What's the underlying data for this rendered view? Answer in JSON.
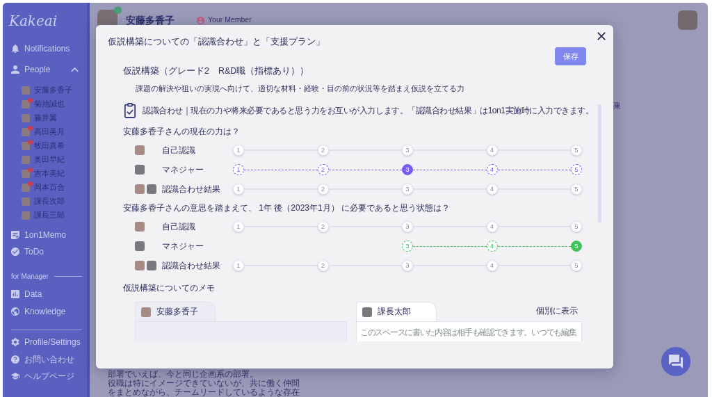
{
  "sidebar": {
    "logo": "Kakeai",
    "items": [
      {
        "label": "Notifications"
      },
      {
        "label": "People",
        "expanded": true,
        "children": [
          {
            "name": "安藤多香子",
            "alert": false
          },
          {
            "name": "菊池誠也",
            "alert": true
          },
          {
            "name": "藤井翼",
            "alert": false
          },
          {
            "name": "高田美月",
            "alert": true
          },
          {
            "name": "牧田真希",
            "alert": true
          },
          {
            "name": "奥田早紀",
            "alert": false
          },
          {
            "name": "吉本美紀",
            "alert": true
          },
          {
            "name": "岡本百合",
            "alert": true
          },
          {
            "name": "課長次郎",
            "alert": false
          },
          {
            "name": "課長三郎",
            "alert": false
          }
        ]
      },
      {
        "label": "1on1Memo"
      },
      {
        "label": "ToDo"
      }
    ],
    "section_label": "for Manager",
    "manager_items": [
      {
        "label": "Data"
      },
      {
        "label": "Knowledge"
      }
    ],
    "footer_items": [
      {
        "label": "Profile/Settings"
      },
      {
        "label": "お問い合わせ"
      },
      {
        "label": "ヘルプページ"
      }
    ]
  },
  "header": {
    "name": "安藤多香子",
    "online": true,
    "role": "Your Member"
  },
  "background": {
    "fragment": "果",
    "note_lines": [
      "部署でいえば、今と同じ企画系の部署。",
      "役職は特にイメージできていないが、共に働く仲間",
      "をまとめながら、チームリードしているような存在"
    ]
  },
  "dialog": {
    "title": "仮説構築についての「認識合わせ」と「支援プラン」",
    "save_button": "保存",
    "skill": {
      "title": "仮説構築（グレード2　R&D職（指標あり））",
      "description": "課題の解決や狙いの実現へ向けて、適切な材料・経験・目の前の状況等を踏まえ仮説を立てる力"
    },
    "notice": "認識合わせ｜現在の力や将来必要であると思う力をお互いが入力します。「認識合わせ結果」は1on1実施時に入力できます。",
    "questions": [
      {
        "text": "安藤多香子さんの現在の力は？",
        "rows": [
          {
            "kind": "self",
            "label": "自己認識",
            "points": [
              {
                "label": "1",
                "selected": false
              },
              {
                "label": "2",
                "selected": false
              },
              {
                "label": "3",
                "selected": false
              },
              {
                "label": "4",
                "selected": false
              },
              {
                "label": "5",
                "selected": false
              }
            ]
          },
          {
            "kind": "manager",
            "label": "マネジャー",
            "color": "#7b5cf2",
            "points": [
              {
                "label": "1",
                "selected": false
              },
              {
                "label": "2",
                "selected": false
              },
              {
                "label": "3",
                "selected": true
              },
              {
                "label": "4",
                "selected": false
              },
              {
                "label": "5",
                "selected": false
              }
            ]
          },
          {
            "kind": "result",
            "label": "認識合わせ結果",
            "points": [
              {
                "label": "1",
                "selected": false
              },
              {
                "label": "2",
                "selected": false
              },
              {
                "label": "3",
                "selected": false
              },
              {
                "label": "4",
                "selected": false
              },
              {
                "label": "5",
                "selected": false
              }
            ]
          }
        ]
      },
      {
        "text": "安藤多香子さんの意思を踏まえて、 1年 後（2023年1月） に必要であると思う状態は？",
        "rows": [
          {
            "kind": "self",
            "label": "自己認識",
            "points": [
              {
                "label": "1",
                "selected": false
              },
              {
                "label": "2",
                "selected": false
              },
              {
                "label": "3",
                "selected": false
              },
              {
                "label": "4",
                "selected": false
              },
              {
                "label": "5",
                "selected": false
              }
            ]
          },
          {
            "kind": "manager",
            "label": "マネジャー",
            "color": "#3ec45a",
            "points": [
              {
                "label": "3",
                "selected": false
              },
              {
                "label": "4",
                "selected": false
              },
              {
                "label": "5",
                "selected": true
              }
            ]
          },
          {
            "kind": "result",
            "label": "認識合わせ結果",
            "points": [
              {
                "label": "1",
                "selected": false
              },
              {
                "label": "2",
                "selected": false
              },
              {
                "label": "3",
                "selected": false
              },
              {
                "label": "4",
                "selected": false
              },
              {
                "label": "5",
                "selected": false
              }
            ]
          }
        ]
      }
    ],
    "memo": {
      "title": "仮説構築についてのメモ",
      "panels": [
        {
          "kind": "self",
          "author": "安藤多香子",
          "editable": false
        },
        {
          "kind": "manager",
          "author": "課長太郎",
          "editable": true,
          "link": "個別に表示",
          "placeholder": "このスペースに書いた内容は相手も確認できます。いつでも編集"
        }
      ]
    }
  }
}
